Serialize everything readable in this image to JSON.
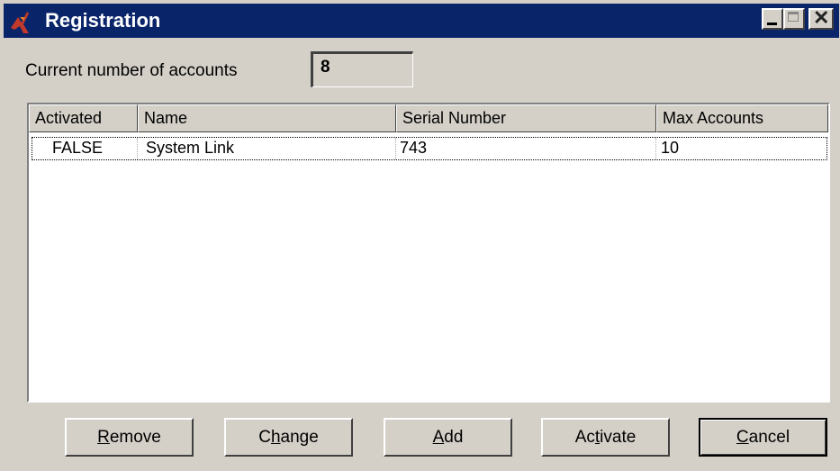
{
  "window": {
    "title": "Registration",
    "controls": {
      "minimize": "minimize-icon",
      "maximize": "maximize-icon",
      "close": "close-icon"
    }
  },
  "accounts": {
    "label": "Current number of accounts",
    "count": "8"
  },
  "table": {
    "columns": [
      "Activated",
      "Name",
      "Serial Number",
      "Max Accounts"
    ],
    "rows": [
      {
        "activated": "FALSE",
        "name": "System Link",
        "serial": "743",
        "max_accounts": "10"
      }
    ]
  },
  "buttons": {
    "remove": {
      "pre": "",
      "acc": "R",
      "post": "emove"
    },
    "change": {
      "pre": "C",
      "acc": "h",
      "post": "ange"
    },
    "add": {
      "pre": "",
      "acc": "A",
      "post": "dd"
    },
    "activate": {
      "pre": "Ac",
      "acc": "t",
      "post": "ivate"
    },
    "cancel": {
      "pre": "",
      "acc": "C",
      "post": "ancel"
    }
  },
  "colors": {
    "titlebar": "#0a246a",
    "face": "#d4d0c8",
    "window_bg": "#ffffff"
  }
}
